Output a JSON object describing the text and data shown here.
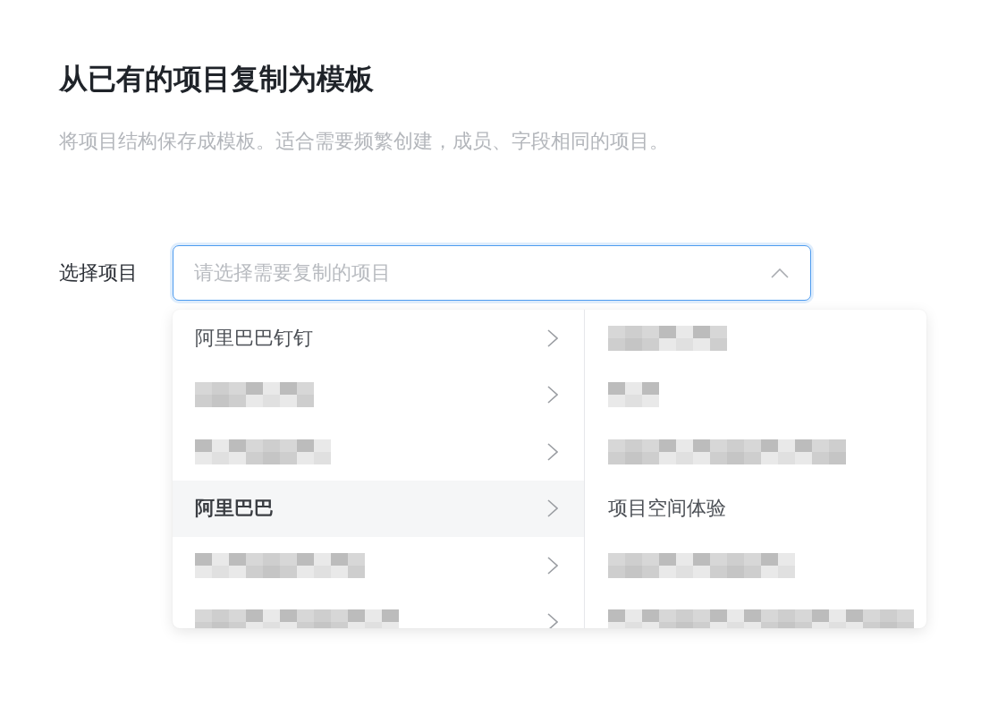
{
  "page": {
    "title": "从已有的项目复制为模板",
    "description": "将项目结构保存成模板。适合需要频繁创建，成员、字段相同的项目。"
  },
  "form": {
    "label": "选择项目",
    "select": {
      "placeholder": "请选择需要复制的项目",
      "expanded": true
    }
  },
  "cascader": {
    "options": [
      {
        "kind": "text",
        "label": "阿里巴巴钉钉",
        "selected": false
      },
      {
        "kind": "pixelated",
        "selected": false
      },
      {
        "kind": "pixelated",
        "selected": false
      },
      {
        "kind": "text",
        "label": "阿里巴巴",
        "selected": true,
        "children": [
          {
            "kind": "pixelated",
            "selected": false
          },
          {
            "kind": "pixelated",
            "selected": false
          },
          {
            "kind": "pixelated",
            "selected": false
          },
          {
            "kind": "text",
            "label": "项目空间体验",
            "selected": false
          },
          {
            "kind": "pixelated",
            "selected": false
          },
          {
            "kind": "pixelated",
            "selected": false
          }
        ]
      },
      {
        "kind": "pixelated",
        "selected": false
      },
      {
        "kind": "pixelated",
        "selected": false
      }
    ]
  }
}
